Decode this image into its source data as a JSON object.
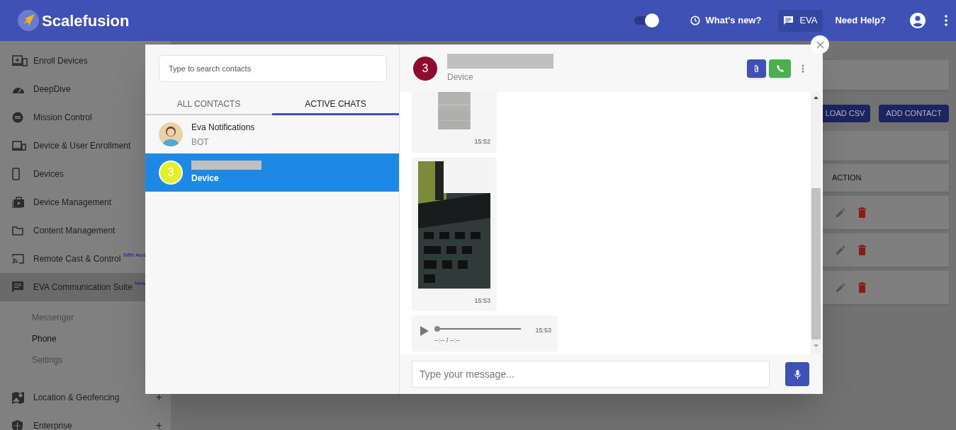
{
  "header": {
    "brand": "Scalefusion",
    "toggle_on": true,
    "links": [
      {
        "kind": "whatsnew",
        "label": "What's new?",
        "selected": false
      },
      {
        "kind": "eva",
        "label": "EVA",
        "selected": true
      },
      {
        "kind": "help",
        "label": "Need Help?",
        "selected": false
      }
    ]
  },
  "sidebar": {
    "items": [
      {
        "label": "Enroll Devices",
        "selected": false
      },
      {
        "label": "DeepDive",
        "selected": false
      },
      {
        "label": "Mission Control",
        "selected": false
      },
      {
        "label": "Device & User Enrollment",
        "selected": false
      },
      {
        "label": "Devices",
        "selected": false
      },
      {
        "label": "Device Management",
        "selected": false
      },
      {
        "label": "Content Management",
        "selected": false
      },
      {
        "label": "Remote Cast & Control",
        "badge": "With Aud",
        "selected": false
      },
      {
        "label": "EVA Communication Suite",
        "badge": "New",
        "selected": true,
        "children": [
          {
            "label": "Messenger",
            "selected": false
          },
          {
            "label": "Phone",
            "selected": true
          },
          {
            "label": "Settings",
            "selected": false
          }
        ]
      },
      {
        "label": "Location & Geofencing",
        "expander": "+",
        "selected": false
      },
      {
        "label": "Enterprise",
        "expander": "+",
        "selected": false
      }
    ]
  },
  "main": {
    "buttons": [
      "LOAD CSV",
      "ADD CONTACT"
    ],
    "table": {
      "columns": [
        "ACTION"
      ]
    }
  },
  "contacts": {
    "search": {
      "placeholder": "Type to search contacts"
    },
    "tabs": [
      {
        "label": "ALL CONTACTS",
        "selected": false
      },
      {
        "label": "ACTIVE CHATS",
        "selected": true
      }
    ],
    "items": [
      {
        "kind": "bot",
        "name": "Eva Notifications",
        "subtitle": "BOT",
        "selected": false
      },
      {
        "kind": "device",
        "badge": "3",
        "color": "#e4ef28",
        "subtitle": "Device",
        "selected": true
      }
    ]
  },
  "chat": {
    "badge": "3",
    "color": "#8e0b2e",
    "subtitle": "Device",
    "messages": [
      {
        "time": "15:52"
      },
      {
        "time": "15:53"
      },
      {
        "kind": "audio",
        "time": "15:53",
        "duration": "--:-- / --:--",
        "level": 0
      }
    ],
    "input": {
      "placeholder": "Type your message..."
    }
  }
}
